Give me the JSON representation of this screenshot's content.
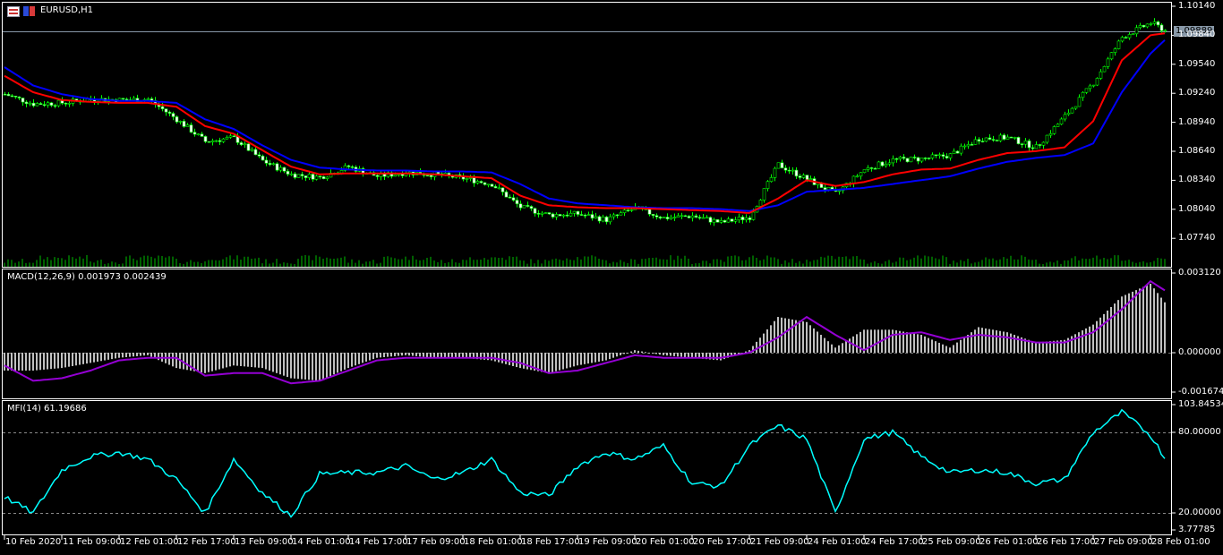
{
  "window": {
    "title": "EURUSD,H1",
    "icons": [
      "chart-window-icon",
      "symbol-icon"
    ]
  },
  "colors": {
    "background": "#000000",
    "candle": "#00ff00",
    "bear_body": "#ffffff",
    "ma_fast": "#ff0000",
    "ma_slow": "#0000ff",
    "macd_hist": "#c0c0c0",
    "macd_signal": "#9400d3",
    "mfi": "#00ffff",
    "volume": "#00c000",
    "current_price_bg": "#8898a8"
  },
  "main": {
    "price_axis": [
      "1.10140",
      "1.09840",
      "1.09540",
      "1.09240",
      "1.08940",
      "1.08640",
      "1.08340",
      "1.08040",
      "1.07740"
    ],
    "current_price": "1.09889"
  },
  "macd": {
    "label": "MACD(12,26,9) 0.001973 0.002439",
    "axis": [
      "0.003120",
      "0.000000",
      "-0.001674"
    ]
  },
  "mfi": {
    "label": "MFI(14) 61.19686",
    "axis": [
      "103.84534",
      "80.00000",
      "20.00000",
      "3.77785"
    ]
  },
  "time_axis": [
    "10 Feb 2020",
    "11 Feb 09:00",
    "12 Feb 01:00",
    "12 Feb 17:00",
    "13 Feb 09:00",
    "14 Feb 01:00",
    "14 Feb 17:00",
    "17 Feb 09:00",
    "18 Feb 01:00",
    "18 Feb 17:00",
    "19 Feb 09:00",
    "20 Feb 01:00",
    "20 Feb 17:00",
    "21 Feb 09:00",
    "24 Feb 01:00",
    "24 Feb 17:00",
    "25 Feb 09:00",
    "26 Feb 01:00",
    "26 Feb 17:00",
    "27 Feb 09:00",
    "28 Feb 01:00"
  ],
  "chart_data": [
    {
      "type": "line",
      "title": "EURUSD,H1",
      "x": [
        "10 Feb 17:00",
        "11 Feb 01:00",
        "11 Feb 09:00",
        "11 Feb 17:00",
        "12 Feb 01:00",
        "12 Feb 09:00",
        "12 Feb 17:00",
        "13 Feb 01:00",
        "13 Feb 09:00",
        "13 Feb 17:00",
        "14 Feb 01:00",
        "14 Feb 09:00",
        "14 Feb 17:00",
        "17 Feb 01:00",
        "17 Feb 09:00",
        "17 Feb 17:00",
        "18 Feb 01:00",
        "18 Feb 09:00",
        "18 Feb 17:00",
        "19 Feb 01:00",
        "19 Feb 09:00",
        "19 Feb 17:00",
        "20 Feb 01:00",
        "20 Feb 09:00",
        "20 Feb 17:00",
        "21 Feb 01:00",
        "21 Feb 09:00",
        "21 Feb 17:00",
        "24 Feb 01:00",
        "24 Feb 09:00",
        "24 Feb 17:00",
        "25 Feb 01:00",
        "25 Feb 09:00",
        "25 Feb 17:00",
        "26 Feb 01:00",
        "26 Feb 09:00",
        "26 Feb 17:00",
        "27 Feb 01:00",
        "27 Feb 09:00",
        "27 Feb 17:00",
        "28 Feb 01:00",
        "28 Feb 05:00"
      ],
      "ylim": [
        1.0762,
        1.1017
      ],
      "series": [
        {
          "role": "close",
          "values": [
            1.0923,
            1.0913,
            1.0914,
            1.0918,
            1.0917,
            1.0918,
            1.0897,
            1.0874,
            1.0878,
            1.0854,
            1.084,
            1.0837,
            1.0848,
            1.0838,
            1.0842,
            1.084,
            1.0836,
            1.083,
            1.0806,
            1.0798,
            1.0799,
            1.0793,
            1.0805,
            1.0795,
            1.0797,
            1.079,
            1.0796,
            1.085,
            1.0835,
            1.082,
            1.0845,
            1.0855,
            1.0856,
            1.086,
            1.0877,
            1.0878,
            1.0868,
            1.09,
            1.0935,
            1.0982,
            1.0997,
            1.0989
          ]
        },
        {
          "role": "ma_fast",
          "values": [
            1.0942,
            1.0925,
            1.0917,
            1.0915,
            1.0914,
            1.0914,
            1.091,
            1.089,
            1.0882,
            1.0865,
            1.0848,
            1.084,
            1.0841,
            1.0841,
            1.0841,
            1.084,
            1.0838,
            1.0836,
            1.0818,
            1.0808,
            1.0806,
            1.0805,
            1.0805,
            1.0804,
            1.0803,
            1.0802,
            1.08,
            1.0815,
            1.0834,
            1.0828,
            1.0832,
            1.084,
            1.0845,
            1.0846,
            1.0855,
            1.0862,
            1.0864,
            1.0868,
            1.0895,
            1.0958,
            1.0984,
            1.0986
          ]
        },
        {
          "role": "ma_slow",
          "values": [
            1.0951,
            1.0932,
            1.0923,
            1.0918,
            1.0916,
            1.0916,
            1.0914,
            1.0897,
            1.0887,
            1.087,
            1.0855,
            1.0847,
            1.0845,
            1.0844,
            1.0844,
            1.0843,
            1.0843,
            1.0842,
            1.083,
            1.0815,
            1.081,
            1.0808,
            1.0806,
            1.0805,
            1.0805,
            1.0804,
            1.0802,
            1.0808,
            1.0822,
            1.0824,
            1.0826,
            1.083,
            1.0834,
            1.0838,
            1.0846,
            1.0853,
            1.0857,
            1.086,
            1.0872,
            1.0925,
            1.0965,
            1.0979
          ]
        }
      ]
    },
    {
      "type": "bar",
      "title": "MACD(12,26,9)",
      "ylim": [
        -0.001674,
        0.00312
      ],
      "series": [
        {
          "role": "macd",
          "values": [
            -0.0007,
            -0.0007,
            -0.0006,
            -0.0004,
            -0.0002,
            -0.0001,
            -0.0006,
            -0.0008,
            -0.0005,
            -0.0006,
            -0.001,
            -0.0011,
            -0.0006,
            -0.0002,
            -0.0001,
            -0.0002,
            -0.0002,
            -0.0003,
            -0.0006,
            -0.0008,
            -0.0005,
            -0.0003,
            0.0001,
            -0.0001,
            -0.0002,
            -0.0003,
            0.0001,
            0.0014,
            0.0012,
            0.0002,
            0.0009,
            0.0009,
            0.0007,
            0.0002,
            0.001,
            0.0008,
            0.0004,
            0.0005,
            0.0011,
            0.0022,
            0.0027,
            0.001973
          ]
        },
        {
          "role": "signal",
          "values": [
            -0.0005,
            -0.0011,
            -0.001,
            -0.0007,
            -0.0003,
            -0.0002,
            -0.0002,
            -0.0009,
            -0.0008,
            -0.0008,
            -0.0012,
            -0.0011,
            -0.0007,
            -0.0003,
            -0.0002,
            -0.0002,
            -0.0002,
            -0.0002,
            -0.0004,
            -0.0008,
            -0.0007,
            -0.0004,
            -0.0001,
            -0.0002,
            -0.0002,
            -0.0002,
            0.0,
            0.0006,
            0.0014,
            0.0007,
            0.0001,
            0.0007,
            0.0008,
            0.0005,
            0.0007,
            0.0006,
            0.0004,
            0.0004,
            0.0008,
            0.0017,
            0.0028,
            0.002439
          ]
        }
      ]
    },
    {
      "type": "line",
      "title": "MFI(14)",
      "ylim": [
        3.77785,
        103.84534
      ],
      "levels": [
        20,
        80
      ],
      "series": [
        {
          "role": "mfi",
          "values": [
            32,
            20,
            52,
            62,
            65,
            60,
            45,
            20,
            60,
            35,
            18,
            49,
            50,
            50,
            55,
            45,
            50,
            60,
            35,
            33,
            55,
            65,
            60,
            70,
            42,
            40,
            70,
            85,
            75,
            20,
            75,
            80,
            62,
            50,
            52,
            50,
            42,
            45,
            80,
            95,
            78,
            61.19686
          ]
        }
      ]
    }
  ]
}
